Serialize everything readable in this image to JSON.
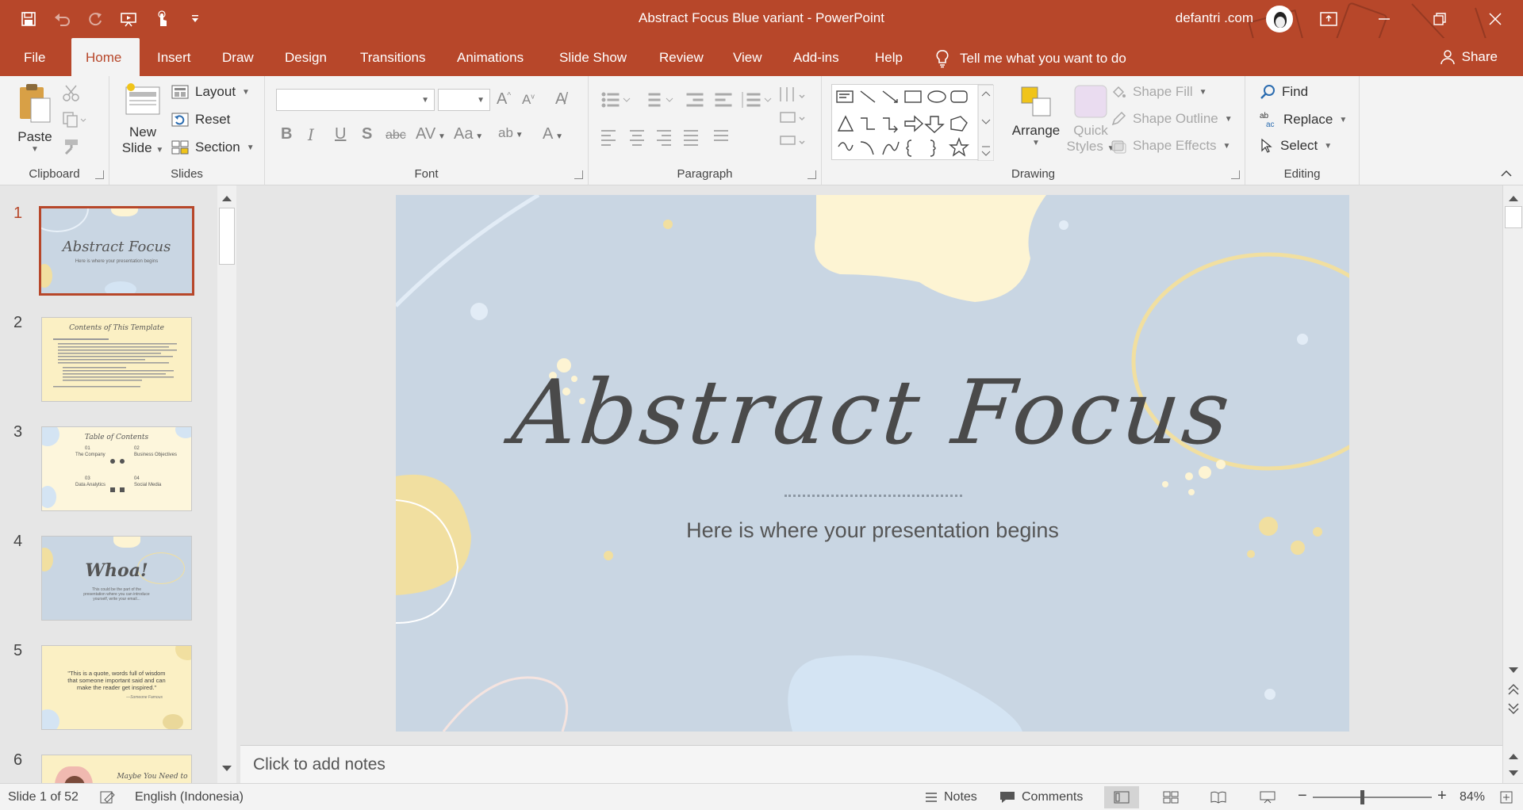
{
  "window": {
    "title": "Abstract Focus Blue variant  -  PowerPoint",
    "account": "defantri .com"
  },
  "tabs": [
    "File",
    "Home",
    "Insert",
    "Draw",
    "Design",
    "Transitions",
    "Animations",
    "Slide Show",
    "Review",
    "View",
    "Add-ins",
    "Help"
  ],
  "active_tab": "Home",
  "tell_me": "Tell me what you want to do",
  "share": "Share",
  "ribbon": {
    "clipboard": {
      "label": "Clipboard",
      "paste": "Paste"
    },
    "slides": {
      "label": "Slides",
      "new_slide_1": "New",
      "new_slide_2": "Slide",
      "layout": "Layout",
      "reset": "Reset",
      "section": "Section"
    },
    "font": {
      "label": "Font"
    },
    "paragraph": {
      "label": "Paragraph"
    },
    "drawing": {
      "label": "Drawing",
      "arrange": "Arrange",
      "quick_styles_1": "Quick",
      "quick_styles_2": "Styles",
      "shape_fill": "Shape Fill",
      "shape_outline": "Shape Outline",
      "shape_effects": "Shape Effects"
    },
    "editing": {
      "label": "Editing",
      "find": "Find",
      "replace": "Replace",
      "select": "Select"
    }
  },
  "thumbnails": [
    {
      "num": "1",
      "title": "Abstract Focus",
      "sub": "Here is where your presentation begins"
    },
    {
      "num": "2",
      "title": "Contents of This Template",
      "sub": ""
    },
    {
      "num": "3",
      "title": "Table of Contents",
      "items": [
        "The Company",
        "Business Objectives",
        "Data Analytics",
        "Social Media"
      ],
      "nums": [
        "01",
        "02",
        "03",
        "04"
      ]
    },
    {
      "num": "4",
      "title": "Whoa!",
      "sub": "This could be the part of the presentation where you can introduce yourself, write your email..."
    },
    {
      "num": "5",
      "title": "\"This is a quote, words full of wisdom that someone important said and can make the reader get inspired.\"",
      "sub": "—Someone Famous"
    },
    {
      "num": "6",
      "title": "Maybe You Need to"
    }
  ],
  "slide": {
    "title": "Abstract Focus",
    "subtitle": "Here is where your presentation begins"
  },
  "notes_placeholder": "Click to add notes",
  "status": {
    "slide_counter": "Slide 1 of 52",
    "language": "English (Indonesia)",
    "notes": "Notes",
    "comments": "Comments",
    "zoom": "84%"
  },
  "colors": {
    "accent": "#b7472a",
    "slide_bg": "#c9d6e3",
    "blob_yellow": "#fdf4d3",
    "blob_blue": "#d4e4f3"
  }
}
